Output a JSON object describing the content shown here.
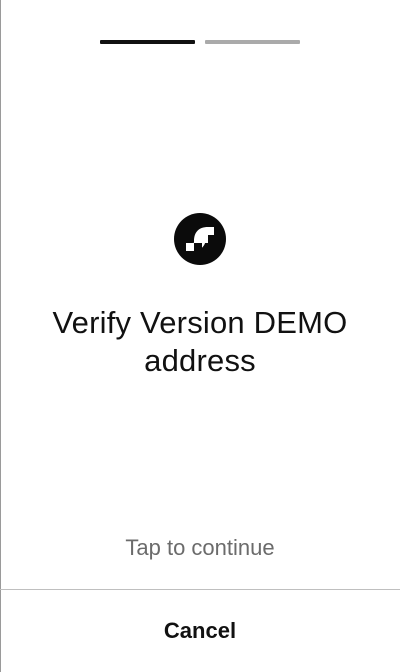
{
  "progress": {
    "current_step": 1,
    "total_steps": 2
  },
  "logo": {
    "icon": "flow-logo-icon"
  },
  "title": {
    "line1": "Verify Version DEMO",
    "line2": "address"
  },
  "hint": "Tap to continue",
  "footer": {
    "cancel_label": "Cancel"
  },
  "colors": {
    "active_step": "#111111",
    "inactive_step": "#aaaaaa",
    "hint_text": "#6b6b6b",
    "divider": "#bfbfbf"
  }
}
